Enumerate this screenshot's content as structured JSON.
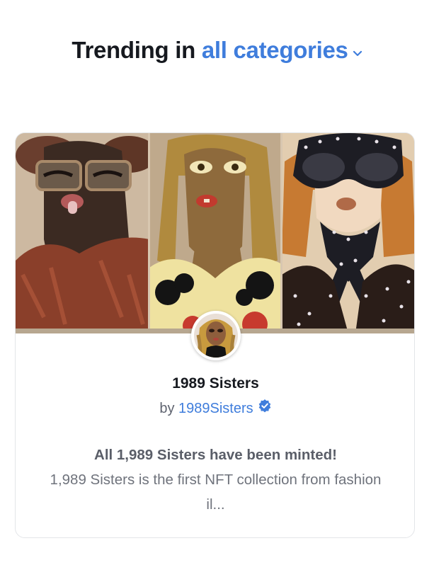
{
  "heading": {
    "prefix": "Trending in",
    "category": "all categories"
  },
  "card": {
    "collection_name": "1989 Sisters",
    "by_label": "by",
    "creator": "1989Sisters",
    "verified_icon": "verified-badge-icon",
    "description_lead": "All 1,989 Sisters have been minted!",
    "description_rest": "1,989 Sisters is the first NFT collection from fashion il..."
  },
  "colors": {
    "accent": "#3f7ddc",
    "heading": "#16191f",
    "muted": "#6f737c"
  }
}
